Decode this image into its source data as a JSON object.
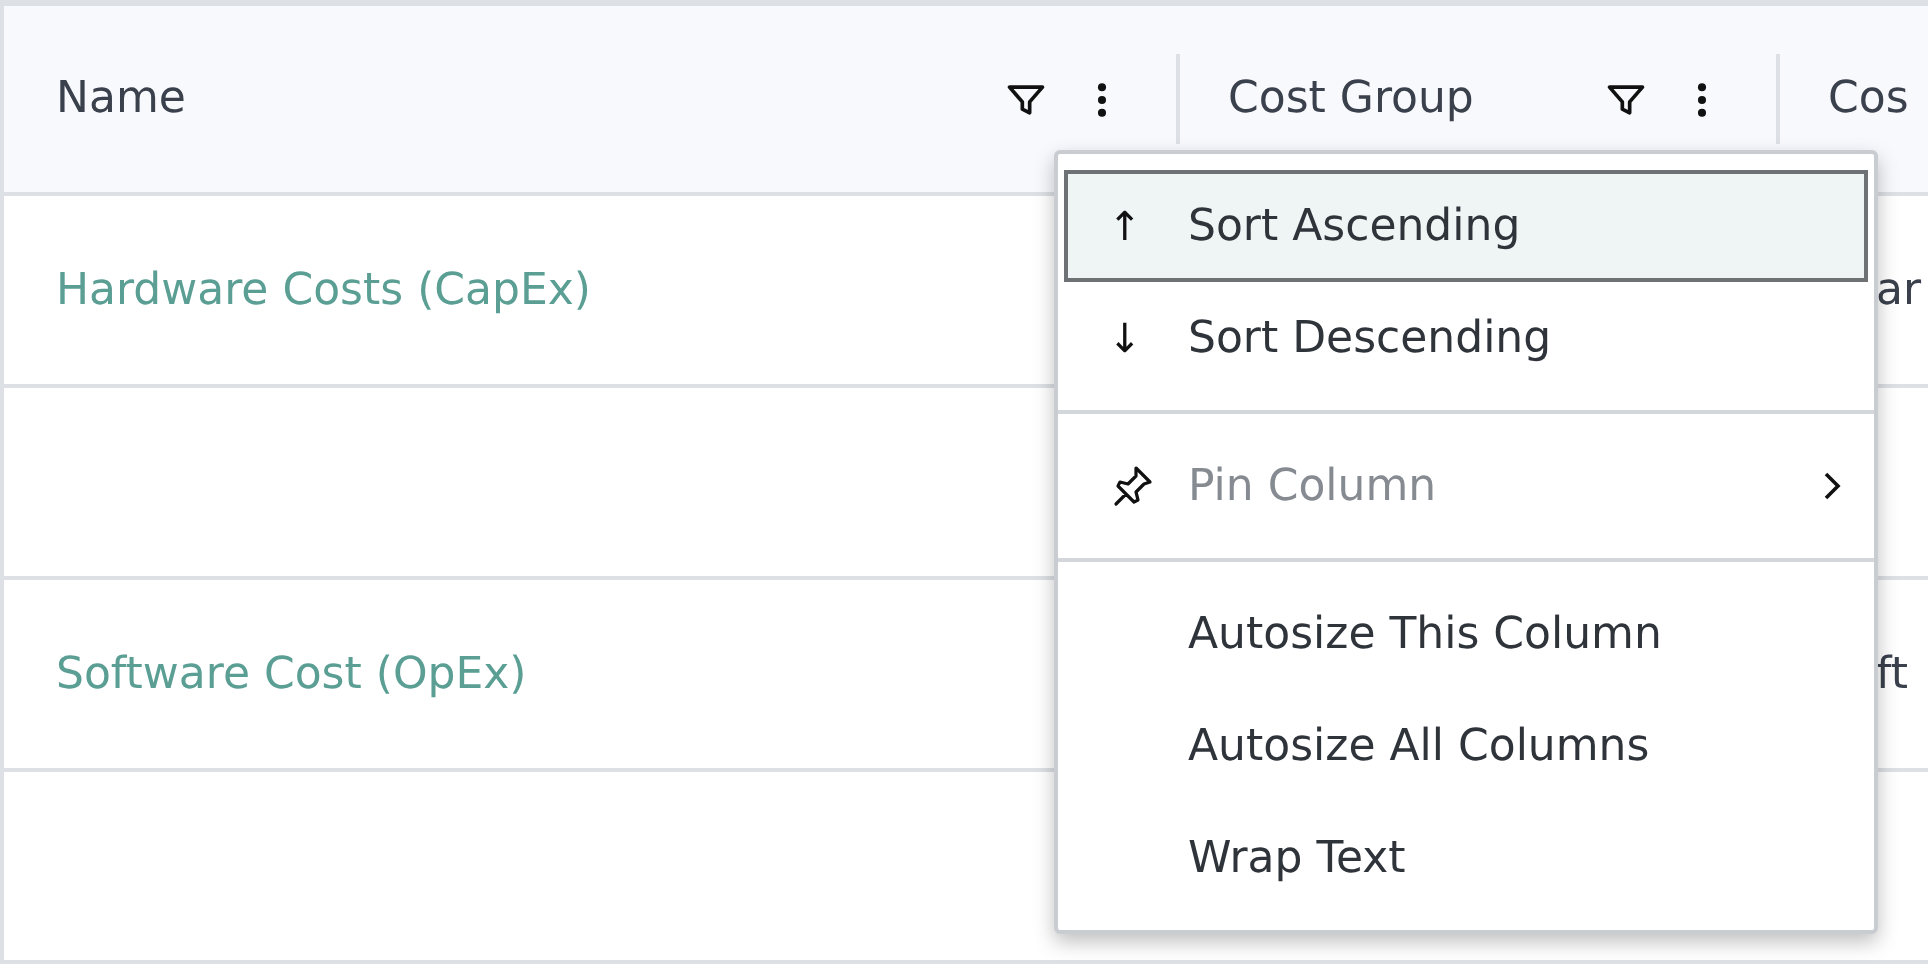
{
  "table": {
    "columns": [
      {
        "label": "Name",
        "kind": "filterable"
      },
      {
        "label": "Cost Group",
        "kind": "filterable"
      },
      {
        "label": "Cos",
        "kind": "plain"
      }
    ],
    "rows": [
      {
        "cells": [
          "Hardware Costs (CapEx)",
          "",
          "ar"
        ]
      },
      {
        "cells": [
          "",
          "",
          ""
        ]
      },
      {
        "cells": [
          "Software Cost (OpEx)",
          "",
          "ft"
        ]
      },
      {
        "cells": [
          "",
          "",
          ""
        ]
      }
    ]
  },
  "column_menu": {
    "items": [
      {
        "kind": "item",
        "icon": "↑",
        "label": "Sort Ascending",
        "selected": true,
        "disabled": false
      },
      {
        "kind": "item",
        "icon": "↓",
        "label": "Sort Descending",
        "selected": false,
        "disabled": false
      },
      {
        "kind": "separator"
      },
      {
        "kind": "pin",
        "label": "Pin Column",
        "selected": false,
        "disabled": true,
        "submenu": true
      },
      {
        "kind": "separator"
      },
      {
        "kind": "item",
        "label": "Autosize This Column",
        "selected": false,
        "disabled": false
      },
      {
        "kind": "item",
        "label": "Autosize All Columns",
        "selected": false,
        "disabled": false
      },
      {
        "kind": "item",
        "label": "Wrap Text",
        "selected": false,
        "disabled": false
      }
    ]
  }
}
